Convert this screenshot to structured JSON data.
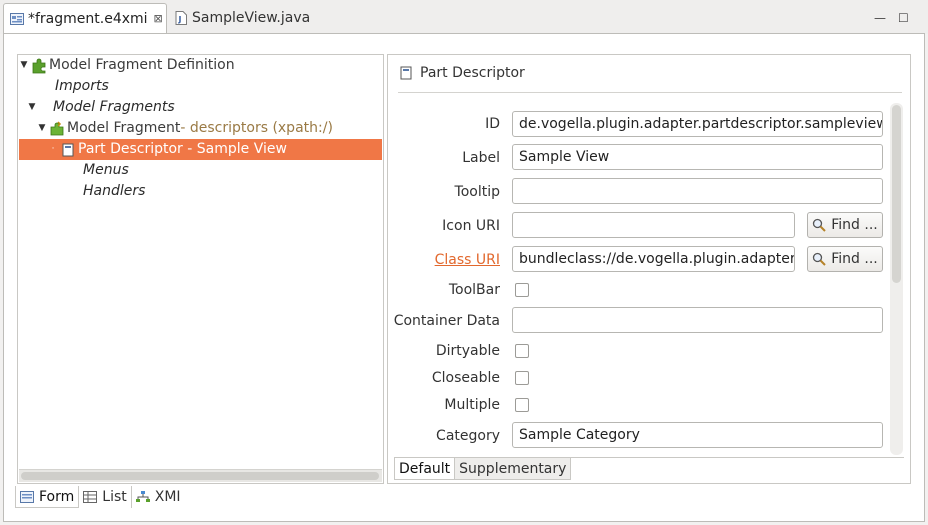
{
  "editor_tabs": [
    {
      "label": "*fragment.e4xmi",
      "icon": "e4xmi-file-icon",
      "active": true,
      "close": "⊠"
    },
    {
      "label": "SampleView.java",
      "icon": "java-file-icon",
      "active": false
    }
  ],
  "window_controls": {
    "minimize": "—",
    "maximize": "☐"
  },
  "tree": [
    {
      "label": "Model Fragment Definition",
      "depth": 0,
      "expanded": true,
      "icon": "puzzle-icon",
      "italic": false
    },
    {
      "label": "Imports",
      "depth": 1,
      "italic": true
    },
    {
      "label": "Model Fragments",
      "depth": 1,
      "expanded": true,
      "italic": true
    },
    {
      "label": "Model Fragment",
      "suffix": " - descriptors (xpath:/)",
      "depth": 2,
      "expanded": true,
      "icon": "puzzle-fragment-icon"
    },
    {
      "label": "Part Descriptor - Sample View",
      "depth": 3,
      "icon": "part-descriptor-icon",
      "selected": true
    },
    {
      "label": "Menus",
      "depth": 4,
      "italic": true
    },
    {
      "label": "Handlers",
      "depth": 4,
      "italic": true
    }
  ],
  "detail": {
    "title": "Part Descriptor",
    "fields": {
      "id": {
        "label": "ID",
        "value": "de.vogella.plugin.adapter.partdescriptor.sampleview"
      },
      "label": {
        "label": "Label",
        "value": "Sample View"
      },
      "tooltip": {
        "label": "Tooltip",
        "value": ""
      },
      "icon_uri": {
        "label": "Icon URI",
        "value": "",
        "button": "Find ..."
      },
      "class_uri": {
        "label": "Class URI",
        "value": "bundleclass://de.vogella.plugin.adapter/",
        "button": "Find ..."
      },
      "toolbar": {
        "label": "ToolBar",
        "checked": false
      },
      "container_data": {
        "label": "Container Data",
        "value": ""
      },
      "dirtyable": {
        "label": "Dirtyable",
        "checked": false
      },
      "closeable": {
        "label": "Closeable",
        "checked": false
      },
      "multiple": {
        "label": "Multiple",
        "checked": false
      },
      "category": {
        "label": "Category",
        "value": "Sample Category"
      }
    },
    "tabs": [
      "Default",
      "Supplementary"
    ]
  },
  "page_tabs": [
    {
      "label": "Form",
      "icon": "form-icon",
      "active": true
    },
    {
      "label": "List",
      "icon": "list-table-icon",
      "active": false
    },
    {
      "label": "XMI",
      "icon": "xmi-tree-icon",
      "active": false
    }
  ],
  "colors": {
    "selection": "#f07746",
    "link": "#e2682d",
    "fragment_suffix": "#9a7a45"
  }
}
